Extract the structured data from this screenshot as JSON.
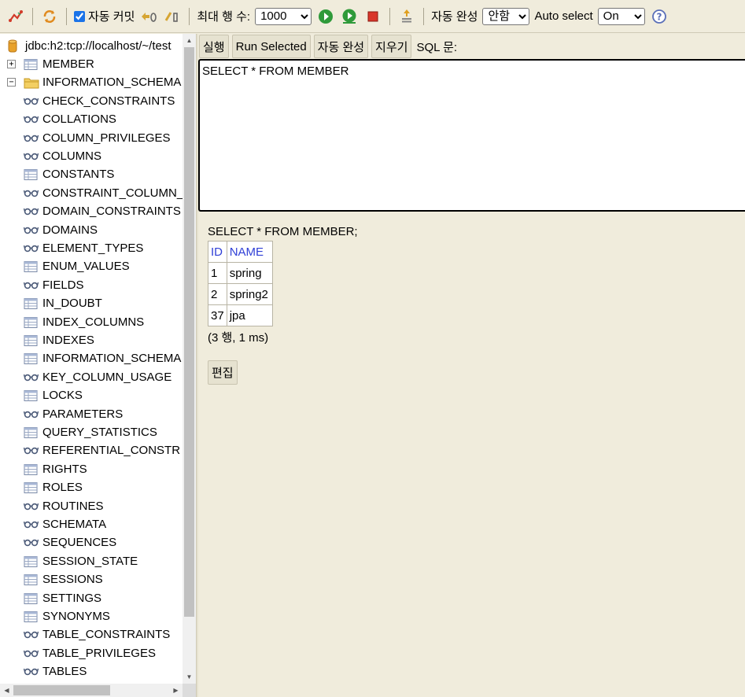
{
  "toolbar": {
    "autocommit_label": "자동 커밋",
    "autocommit_checked": true,
    "max_rows_label": "최대 행 수:",
    "max_rows_value": "1000",
    "autocomplete_label": "자동 완성",
    "autocomplete_value": "안함",
    "auto_select_label": "Auto select",
    "auto_select_value": "On",
    "icons": [
      "disconnect-icon",
      "refresh-icon",
      "rollback-icon",
      "commit-icon",
      "run-icon",
      "run-selected-icon",
      "stop-icon",
      "history-icon",
      "help-icon"
    ]
  },
  "tree": {
    "connection": "jdbc:h2:tcp://localhost/~/test",
    "items": [
      {
        "label": "MEMBER",
        "icon": "table",
        "toggle": "+"
      },
      {
        "label": "INFORMATION_SCHEMA",
        "icon": "folder",
        "toggle": "-"
      },
      {
        "label": "CHECK_CONSTRAINTS",
        "icon": "view"
      },
      {
        "label": "COLLATIONS",
        "icon": "view"
      },
      {
        "label": "COLUMN_PRIVILEGES",
        "icon": "view"
      },
      {
        "label": "COLUMNS",
        "icon": "view"
      },
      {
        "label": "CONSTANTS",
        "icon": "table"
      },
      {
        "label": "CONSTRAINT_COLUMN_",
        "icon": "view"
      },
      {
        "label": "DOMAIN_CONSTRAINTS",
        "icon": "view"
      },
      {
        "label": "DOMAINS",
        "icon": "view"
      },
      {
        "label": "ELEMENT_TYPES",
        "icon": "view"
      },
      {
        "label": "ENUM_VALUES",
        "icon": "table"
      },
      {
        "label": "FIELDS",
        "icon": "view"
      },
      {
        "label": "IN_DOUBT",
        "icon": "table"
      },
      {
        "label": "INDEX_COLUMNS",
        "icon": "table"
      },
      {
        "label": "INDEXES",
        "icon": "table"
      },
      {
        "label": "INFORMATION_SCHEMA",
        "icon": "table"
      },
      {
        "label": "KEY_COLUMN_USAGE",
        "icon": "view"
      },
      {
        "label": "LOCKS",
        "icon": "table"
      },
      {
        "label": "PARAMETERS",
        "icon": "view"
      },
      {
        "label": "QUERY_STATISTICS",
        "icon": "table"
      },
      {
        "label": "REFERENTIAL_CONSTR",
        "icon": "view"
      },
      {
        "label": "RIGHTS",
        "icon": "table"
      },
      {
        "label": "ROLES",
        "icon": "table"
      },
      {
        "label": "ROUTINES",
        "icon": "view"
      },
      {
        "label": "SCHEMATA",
        "icon": "view"
      },
      {
        "label": "SEQUENCES",
        "icon": "view"
      },
      {
        "label": "SESSION_STATE",
        "icon": "table"
      },
      {
        "label": "SESSIONS",
        "icon": "table"
      },
      {
        "label": "SETTINGS",
        "icon": "table"
      },
      {
        "label": "SYNONYMS",
        "icon": "table"
      },
      {
        "label": "TABLE_CONSTRAINTS",
        "icon": "view"
      },
      {
        "label": "TABLE_PRIVILEGES",
        "icon": "view"
      },
      {
        "label": "TABLES",
        "icon": "view"
      }
    ]
  },
  "sql_bar": {
    "run_label": "실행",
    "run_selected_label": "Run Selected",
    "autocomplete_label": "자동 완성",
    "clear_label": "지우기",
    "sql_label": "SQL 문:"
  },
  "editor": {
    "text": "SELECT * FROM MEMBER"
  },
  "result": {
    "statement": "SELECT * FROM MEMBER;",
    "columns": [
      "ID",
      "NAME"
    ],
    "rows": [
      [
        "1",
        "spring"
      ],
      [
        "2",
        "spring2"
      ],
      [
        "37",
        "jpa"
      ]
    ],
    "summary": "(3 행, 1 ms)",
    "edit_label": "편집"
  },
  "colors": {
    "background": "#f0ecdc",
    "header_link": "#2f3fd6"
  }
}
